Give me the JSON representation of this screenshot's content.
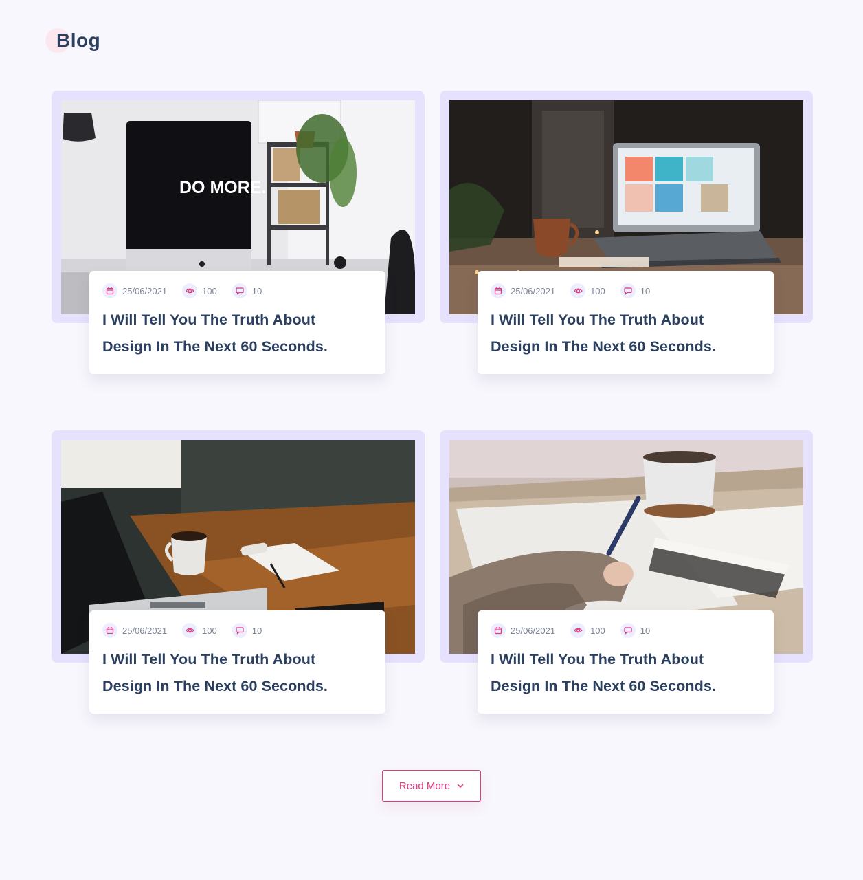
{
  "page": {
    "title": "Blog",
    "accent_color": "#d93b7c",
    "title_color": "#2b4060"
  },
  "posts": [
    {
      "date": "25/06/2021",
      "views": "100",
      "comments": "10",
      "title_line1": "I Will Tell You The Truth About",
      "title_line2": "Design In The Next 60 Seconds.",
      "image": "Desk with monitor showing 'DO MORE.', shelf with plants"
    },
    {
      "date": "25/06/2021",
      "views": "100",
      "comments": "10",
      "title_line1": "I Will Tell You The Truth About",
      "title_line2": "Design In The Next 60 Seconds.",
      "image": "Laptop on wooden table with copper mug and fairy lights"
    },
    {
      "date": "25/06/2021",
      "views": "100",
      "comments": "10",
      "title_line1": "I Will Tell You The Truth About",
      "title_line2": "Design In The Next 60 Seconds.",
      "image": "Laptop, coffee cup and notepad with pen on wooden desk"
    },
    {
      "date": "25/06/2021",
      "views": "100",
      "comments": "10",
      "title_line1": "I Will Tell You The Truth About",
      "title_line2": "Design In The Next 60 Seconds.",
      "image": "Hand writing with pen on paper, mug and notebook"
    }
  ],
  "icons": {
    "date": "calendar-icon",
    "views": "eye-icon",
    "comments": "comment-icon",
    "read_more": "chevron-down-icon"
  },
  "read_more": {
    "label": "Read More"
  },
  "photo_text": {
    "monitor": "DO MORE."
  }
}
